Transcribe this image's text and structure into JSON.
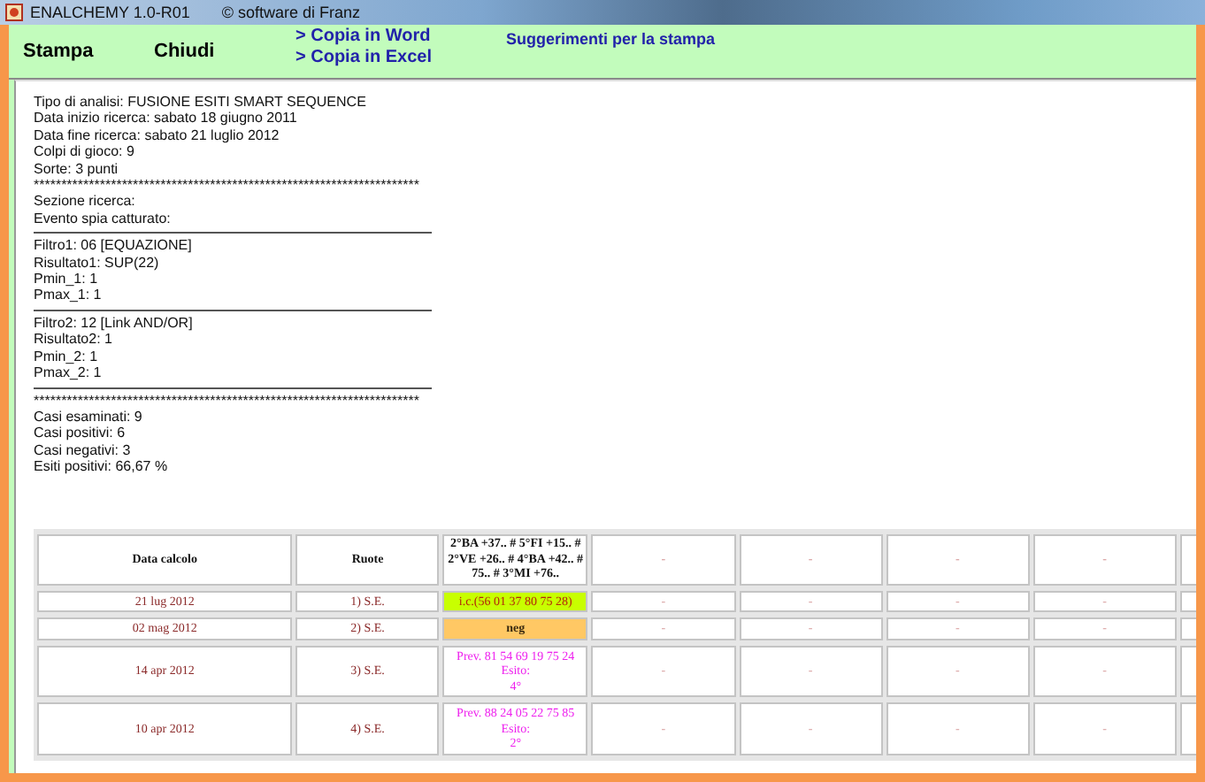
{
  "window": {
    "title": "ENALCHEMY 1.0-R01",
    "subtitle": "© software di Franz"
  },
  "toolbar": {
    "buttons": [
      "Stampa",
      "Chiudi"
    ],
    "links": [
      "> Copia in Word",
      "> Copia in Excel"
    ],
    "hint_link": "Suggerimenti per la stampa"
  },
  "report": [
    {
      "kind": "text",
      "text": "Tipo di analisi: FUSIONE ESITI SMART SEQUENCE"
    },
    {
      "kind": "text",
      "text": "Data inizio ricerca: sabato 18 giugno 2011"
    },
    {
      "kind": "text",
      "text": "Data fine ricerca: sabato 21 luglio 2012"
    },
    {
      "kind": "text",
      "text": "Colpi di gioco: 9"
    },
    {
      "kind": "text",
      "text": "Sorte: 3 punti"
    },
    {
      "kind": "text",
      "text": "**********************************************************************"
    },
    {
      "kind": "text",
      "text": "Sezione ricerca:"
    },
    {
      "kind": "text",
      "text": "Evento spia catturato:"
    },
    {
      "kind": "rule"
    },
    {
      "kind": "text",
      "text": "Filtro1: 06 [EQUAZIONE]"
    },
    {
      "kind": "text",
      "text": "Risultato1: SUP(22)"
    },
    {
      "kind": "text",
      "text": "Pmin_1: 1"
    },
    {
      "kind": "text",
      "text": "Pmax_1: 1"
    },
    {
      "kind": "rule"
    },
    {
      "kind": "text",
      "text": "Filtro2: 12 [Link AND/OR]"
    },
    {
      "kind": "text",
      "text": "Risultato2: 1"
    },
    {
      "kind": "text",
      "text": "Pmin_2: 1"
    },
    {
      "kind": "text",
      "text": "Pmax_2: 1"
    },
    {
      "kind": "rule"
    },
    {
      "kind": "text",
      "text": "**********************************************************************"
    },
    {
      "kind": "text",
      "text": "Casi esaminati: 9"
    },
    {
      "kind": "text",
      "text": "Casi positivi: 6"
    },
    {
      "kind": "text",
      "text": "Casi negativi: 3"
    },
    {
      "kind": "text",
      "text": "Esiti positivi: 66,67 %"
    }
  ],
  "table": {
    "columns": [
      "Data calcolo",
      "Ruote",
      "2°BA +37.. # 5°FI +15.. # 2°VE +26.. # 4°BA +42.. # 75.. # 3°MI +76..",
      "-",
      "-",
      "-",
      "-"
    ],
    "rows": [
      {
        "date": "21 lug 2012",
        "ruote": "1) S.E.",
        "result": {
          "kind": "hit",
          "lines": [
            "i.c.(56 01 37 80 75 28)"
          ]
        },
        "others": [
          "-",
          "-",
          "-",
          "-"
        ]
      },
      {
        "date": "02 mag 2012",
        "ruote": "2) S.E.",
        "result": {
          "kind": "neg",
          "lines": [
            "neg"
          ]
        },
        "others": [
          "-",
          "-",
          "-",
          "-"
        ]
      },
      {
        "date": "14 apr 2012",
        "ruote": "3) S.E.",
        "result": {
          "kind": "prev",
          "lines": [
            "Prev. 81 54 69 19 75 24",
            "Esito:",
            "4°"
          ]
        },
        "others": [
          "-",
          "-",
          "-",
          "-"
        ]
      },
      {
        "date": "10 apr 2012",
        "ruote": "4) S.E.",
        "result": {
          "kind": "prev",
          "lines": [
            "Prev. 88 24 05 22 75 85",
            "Esito:",
            "2°"
          ]
        },
        "others": [
          "-",
          "-",
          "-",
          "-"
        ]
      }
    ]
  }
}
